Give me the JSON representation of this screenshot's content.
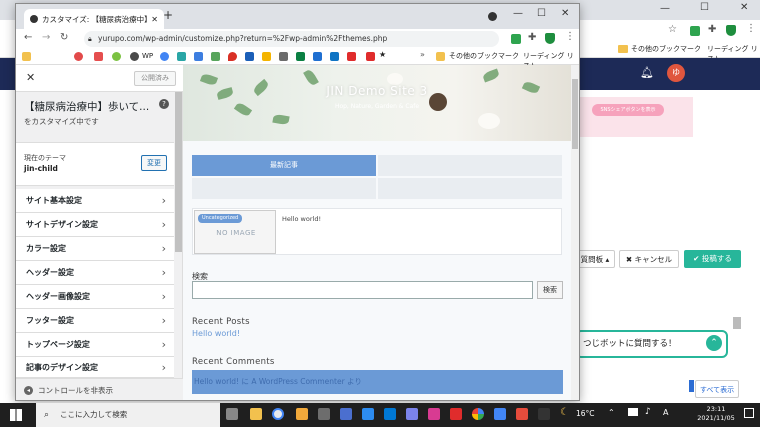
{
  "bg_browser": {
    "bookmarks_other": "その他のブックマーク",
    "reading_list": "リーディング リスト",
    "avatar_letter": "ゆ",
    "pink_banner_label": "SNSシェアボタンを表示",
    "cancel_label": "キャンセル",
    "post_label": "投稿する",
    "dropdown_label": "質問板",
    "chat_label": "つじボットに質問する！",
    "show_all_label": "すべて表示"
  },
  "window": {
    "tab_title": "カスタマイズ: 【糖尿病治療中】歩いて",
    "url": "yurupo.com/wp-admin/customize.php?return=%2Fwp-admin%2Fthemes.php",
    "bookmark_wp": "WP",
    "bookmark_other": "その他のブックマーク",
    "bookmark_reading": "リーディング リスト"
  },
  "sidebar": {
    "published_label": "公開済み",
    "title": "【糖尿病治療中】歩いて...",
    "subtitle": "をカスタマイズ中です",
    "theme_label": "現在のテーマ",
    "theme_name": "jin-child",
    "change_label": "変更",
    "items": [
      {
        "label": "サイト基本設定"
      },
      {
        "label": "サイトデザイン設定"
      },
      {
        "label": "カラー設定"
      },
      {
        "label": "ヘッダー設定"
      },
      {
        "label": "ヘッダー画像設定"
      },
      {
        "label": "フッター設定"
      },
      {
        "label": "トップページ設定"
      },
      {
        "label": "記事のデザイン設定"
      }
    ],
    "hide_controls_label": "コントロールを非表示"
  },
  "preview": {
    "site_title": "JIN Demo Site 3",
    "tagline": "Hop, Nature, Garden & Cafe",
    "latest_tab": "最新記事",
    "category_badge": "Uncategorized",
    "no_image": "NO IMAGE",
    "post_title": "Hello world!",
    "search_label": "検索",
    "search_button": "検索",
    "recent_posts_heading": "Recent Posts",
    "recent_post_1": "Hello world!",
    "recent_comments_heading": "Recent Comments",
    "comment_line": "Hello world! に A WordPress Commenter より"
  },
  "taskbar": {
    "search_placeholder": "ここに入力して検索",
    "weather": "16°C",
    "ime": "A",
    "time": "23:11",
    "date": "2021/11/05"
  },
  "colors": {
    "accent_blue": "#6b9ad6",
    "admin_bar": "#1d2a57",
    "green_button": "#27b69a"
  }
}
